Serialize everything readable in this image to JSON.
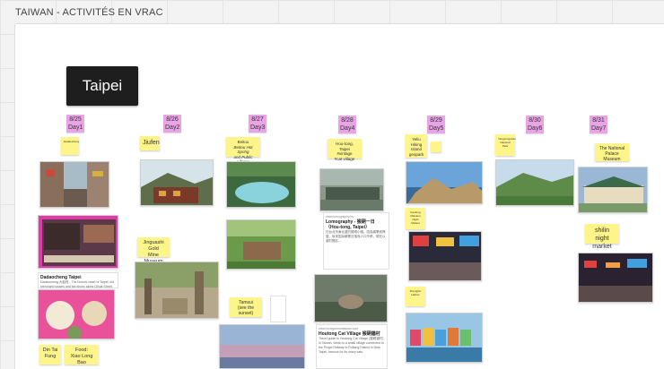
{
  "board": {
    "title": "TAIWAN - ACTIVITÉS EN VRAC"
  },
  "taipei_card": {
    "label": "Taipei"
  },
  "days": [
    {
      "date": "8/25",
      "label": "Day1"
    },
    {
      "date": "8/26",
      "label": "Day2"
    },
    {
      "date": "8/27",
      "label": "Day3"
    },
    {
      "date": "8/28",
      "label": "Day4"
    },
    {
      "date": "8/29",
      "label": "Day5"
    },
    {
      "date": "8/30",
      "label": "Day6"
    },
    {
      "date": "8/31",
      "label": "Day7"
    }
  ],
  "stickies": {
    "dadaocheng": "Dadaocheng",
    "jiufen": "Jiufen",
    "beitou": [
      "Beitou",
      "Beitou Hot Spring",
      "and Public Library"
    ],
    "houtong": [
      "Hou-tong, Taipei",
      "#vintage",
      "#cat village"
    ],
    "geopark": [
      "Yeliu",
      "Hiking",
      "Island",
      "geopark"
    ],
    "yangmingshan": "Yangmingshan National Park",
    "palace": [
      "The National",
      "Palace Museum"
    ],
    "goldmine": [
      "Jinguashi Gold",
      "Mine Museum"
    ],
    "tamsui": [
      "Tamsui",
      "(see the sunset)"
    ],
    "raohe": [
      "Keelung",
      "Miaokou",
      "Night",
      "Market"
    ],
    "shilin": [
      "shilin night",
      "market"
    ],
    "zhengbin": [
      "Zhengbin",
      "Harbor"
    ],
    "dintai": [
      "Din Tai",
      "Fung"
    ],
    "food": [
      "Food:",
      "Xiao Long Bao"
    ]
  },
  "articles": {
    "lomography": {
      "source": "www.lomography.tw",
      "title": "Lomography - 猴硐一日（Hou-tong, Taipei）",
      "body": "在台北市東北邊的猴硐小鎮，因為礦業而興盛，後來因為礦業沒落而人口外移，現在以貓村聞名..."
    },
    "catvillage": {
      "source": "www.foreignersintaiwan.com",
      "title": "Houtong Cat Village 猴硐貓村",
      "body": "Travel guide to Houtong Cat Village (猴硐貓村) in Taiwan, which is a small village connected to the Pingxi Railway in Ruifang District in New Taipei, famous for its many cats."
    },
    "dadaocheng_note": {
      "title": "Dadaocheng Taipei",
      "body": "Dadaocheng 大稻埕 - The historic heart of Taipei, old merchant houses and tea shops along Dihua Street."
    }
  },
  "colors": {
    "day_tag": "#e9a4e6",
    "sticky": "#fdf48a",
    "taipei_card": "#1e1e1e"
  }
}
